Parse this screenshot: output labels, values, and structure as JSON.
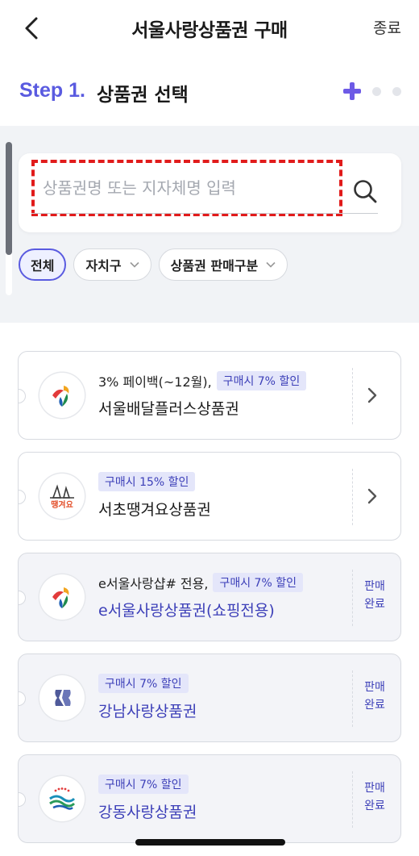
{
  "header": {
    "title": "서울사랑상품권 구매",
    "close_label": "종료"
  },
  "step": {
    "label": "Step 1.",
    "title": "상품권 선택"
  },
  "search": {
    "placeholder": "상품권명 또는 지자체명 입력"
  },
  "filters": [
    {
      "label": "전체"
    },
    {
      "label": "자치구"
    },
    {
      "label": "상품권 판매구분"
    }
  ],
  "vouchers": [
    {
      "promo": "3% 페이백(~12월),",
      "badge": "구매시 7% 할인",
      "name": "서울배달플러스상품권",
      "status": ""
    },
    {
      "promo": "",
      "badge": "구매시 15% 할인",
      "name": "서초땡겨요상품권",
      "status": ""
    },
    {
      "promo": "e서울사랑샵# 전용,",
      "badge": "구매시 7% 할인",
      "name": "e서울사랑상품권(쇼핑전용)",
      "status": "판매완료"
    },
    {
      "promo": "",
      "badge": "구매시 7% 할인",
      "name": "강남사랑상품권",
      "status": "판매완료"
    },
    {
      "promo": "",
      "badge": "구매시 7% 할인",
      "name": "강동사랑상품권",
      "status": "판매완료"
    }
  ],
  "status_text": {
    "sold_line1": "판매",
    "sold_line2": "완료"
  },
  "logo_texts": {
    "seocho": "땡겨요"
  }
}
